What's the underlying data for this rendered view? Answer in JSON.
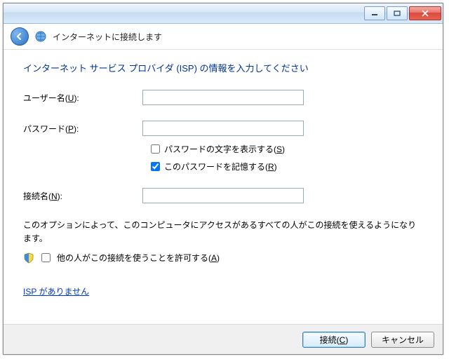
{
  "titlebar": {
    "minimize_name": "minimize",
    "maximize_name": "maximize",
    "close_name": "close"
  },
  "header": {
    "title": "インターネットに接続します"
  },
  "body": {
    "instruction": "インターネット サービス プロバイダ (ISP) の情報を入力してください",
    "username_label_pre": "ユーザー名(",
    "username_accel": "U",
    "username_label_post": "):",
    "password_label_pre": "パスワード(",
    "password_accel": "P",
    "password_label_post": "):",
    "show_pw_pre": "パスワードの文字を表示する(",
    "show_pw_accel": "S",
    "show_pw_post": ")",
    "remember_pw_pre": "このパスワードを記憶する(",
    "remember_pw_accel": "R",
    "remember_pw_post": ")",
    "conn_label_pre": "接続名(",
    "conn_accel": "N",
    "conn_label_post": "):",
    "note_text": "このオプションによって、このコンピュータにアクセスがあるすべての人がこの接続を使えるようになります。",
    "allow_pre": "他の人がこの接続を使うことを許可する(",
    "allow_accel": "A",
    "allow_post": ")",
    "link_text": "ISP がありません",
    "show_pw_checked": false,
    "remember_pw_checked": true,
    "allow_checked": false,
    "username_value": "",
    "password_value": "",
    "connection_value": ""
  },
  "footer": {
    "connect_pre": "接続(",
    "connect_accel": "C",
    "connect_post": ")",
    "cancel": "キャンセル"
  }
}
